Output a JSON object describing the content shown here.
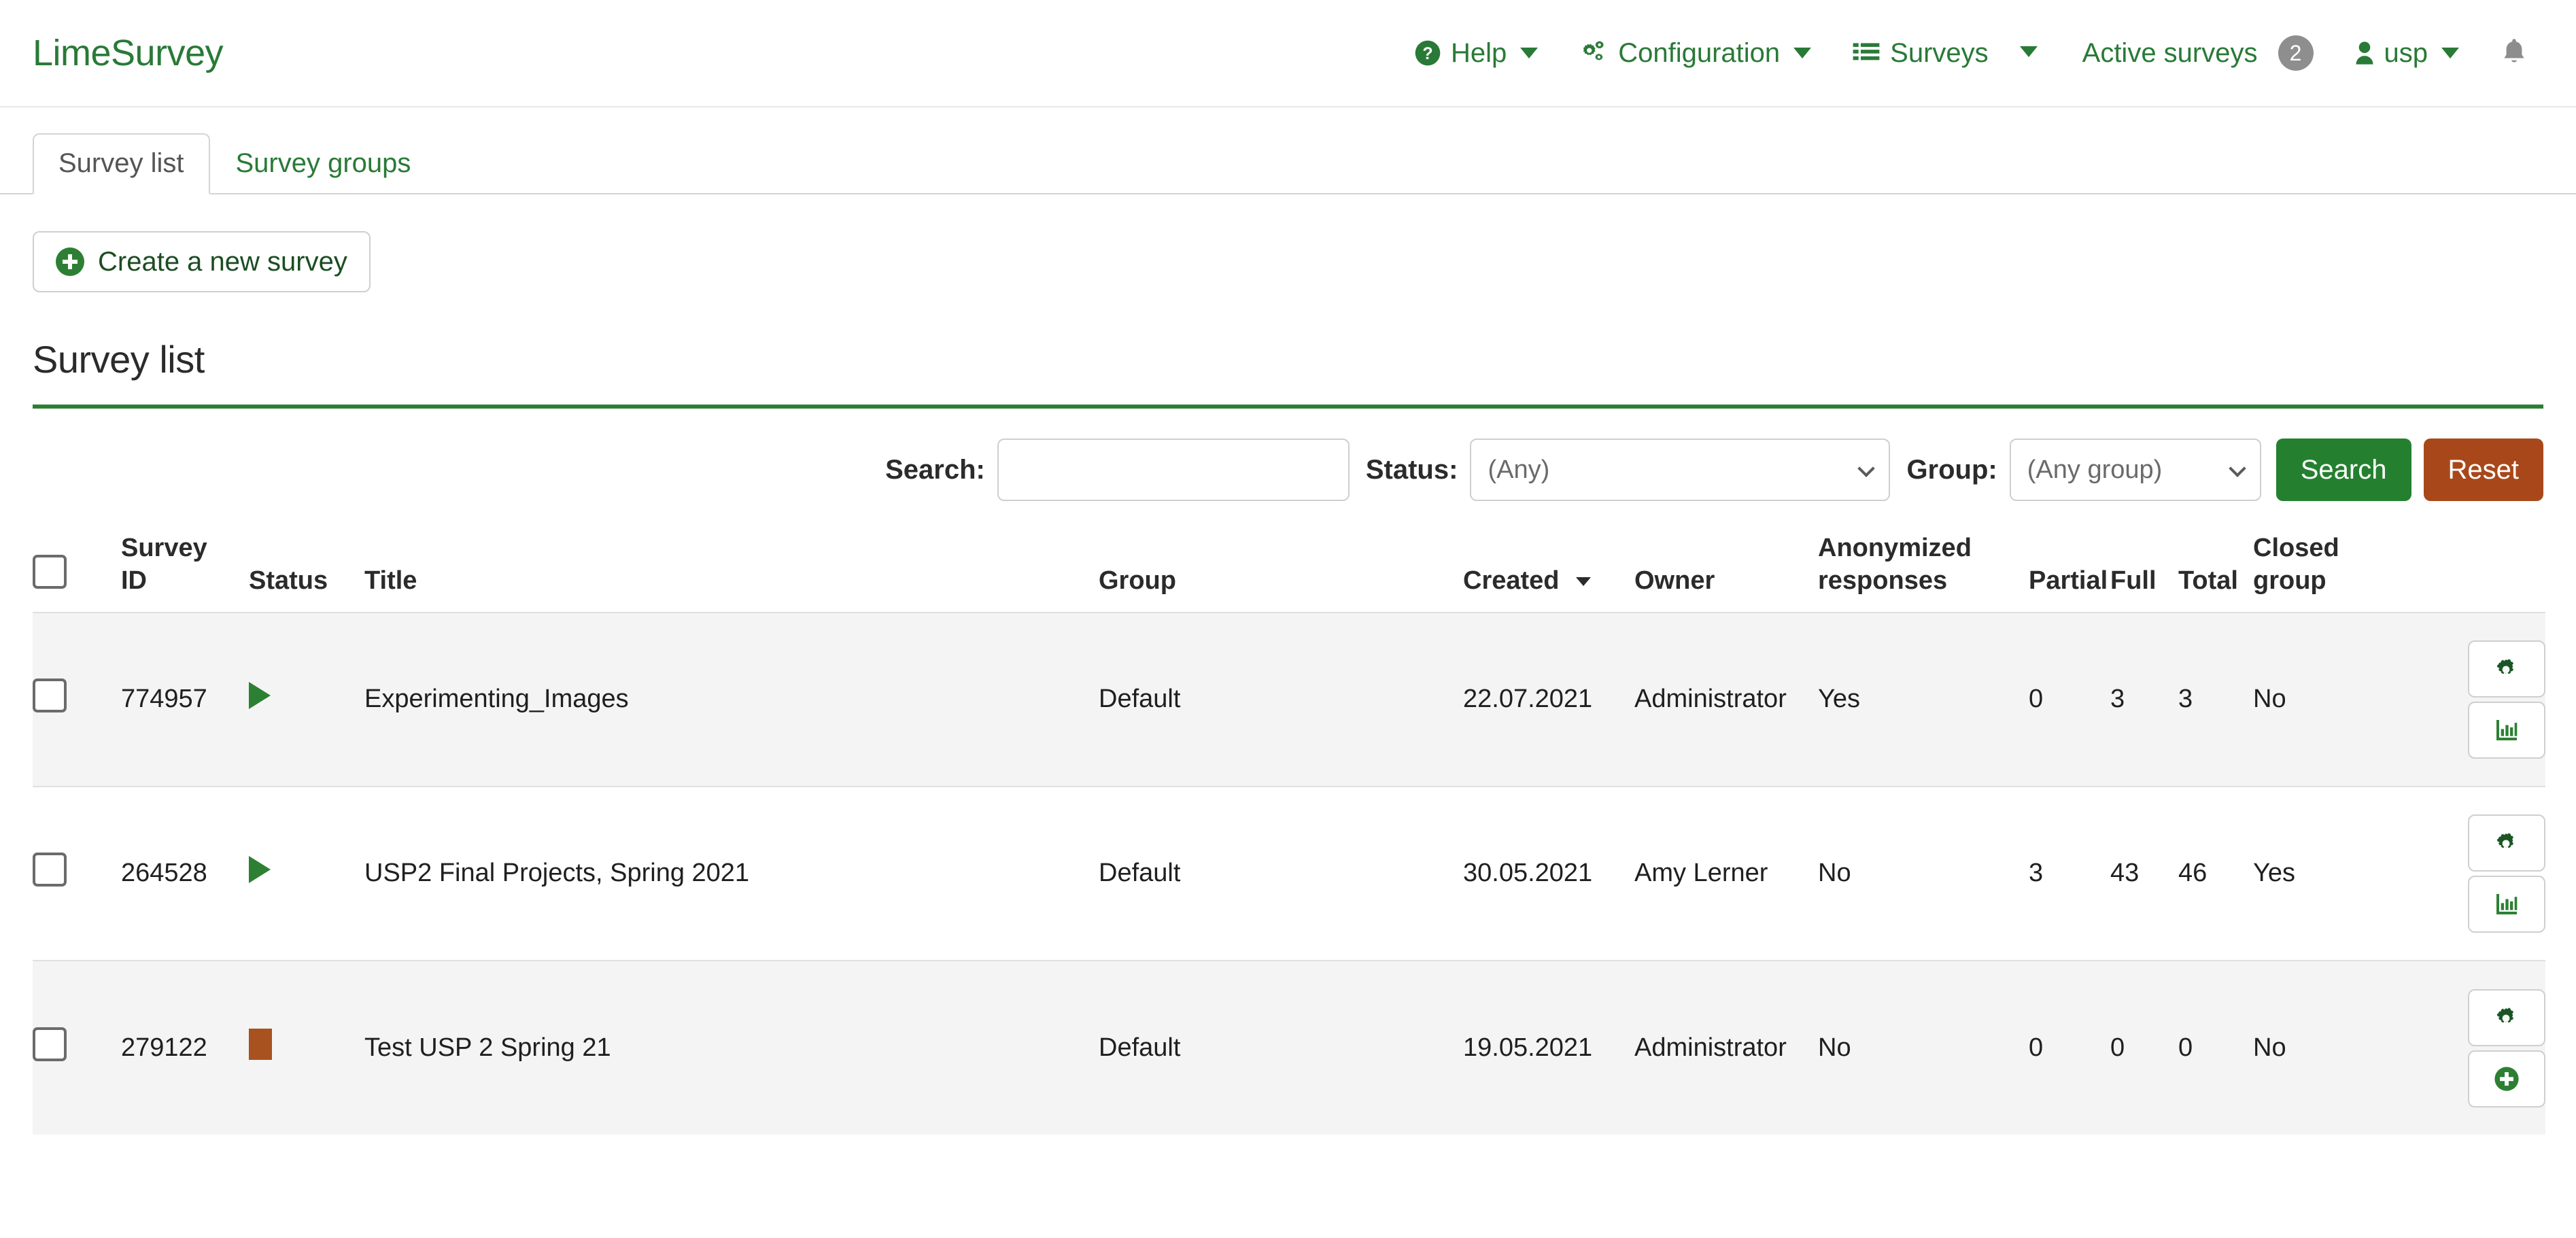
{
  "brand": "LimeSurvey",
  "topnav": {
    "items": [
      {
        "label": "Help",
        "icon": "question-circle-icon",
        "caret": true
      },
      {
        "label": "Configuration",
        "icon": "gears-icon",
        "caret": true
      },
      {
        "label": "Surveys",
        "icon": "list-icon",
        "caret": true
      },
      {
        "label": "Active surveys",
        "icon": "",
        "badge": "2"
      },
      {
        "label": "usp",
        "icon": "user-icon",
        "caret": true
      }
    ],
    "notifications_icon": "bell-icon"
  },
  "tabs": [
    {
      "label": "Survey list",
      "active": true
    },
    {
      "label": "Survey groups",
      "active": false
    }
  ],
  "create_button": {
    "label": "Create a new survey",
    "icon": "circle-plus-icon"
  },
  "page_title": "Survey list",
  "filters": {
    "search_label": "Search:",
    "search_value": "",
    "search_placeholder": "",
    "status_label": "Status:",
    "status_value": "(Any)",
    "status_options": [
      "(Any)"
    ],
    "group_label": "Group:",
    "group_value": "(Any group)",
    "group_options": [
      "(Any group)"
    ],
    "search_button": "Search",
    "reset_button": "Reset"
  },
  "colors": {
    "brand_green": "#297a37",
    "accent_green": "#2d8033",
    "search_button": "#24802f",
    "reset_button": "#a8481a",
    "status_active": "#2d8033",
    "status_expired": "#a8521f",
    "row_alt": "#f4f4f4"
  },
  "table": {
    "columns": [
      {
        "key": "select",
        "label": ""
      },
      {
        "key": "id",
        "label": "Survey ID"
      },
      {
        "key": "status",
        "label": "Status"
      },
      {
        "key": "title",
        "label": "Title"
      },
      {
        "key": "group",
        "label": "Group"
      },
      {
        "key": "created",
        "label": "Created",
        "sorted": true,
        "sort_dir": "desc"
      },
      {
        "key": "owner",
        "label": "Owner"
      },
      {
        "key": "anon",
        "label": "Anonymized responses"
      },
      {
        "key": "partial",
        "label": "Partial"
      },
      {
        "key": "full",
        "label": "Full"
      },
      {
        "key": "total",
        "label": "Total"
      },
      {
        "key": "closed",
        "label": "Closed group"
      },
      {
        "key": "actions",
        "label": ""
      }
    ],
    "header": {
      "survey_id_line1": "Survey",
      "survey_id_line2": "ID",
      "status": "Status",
      "title": "Title",
      "group": "Group",
      "created": "Created",
      "owner": "Owner",
      "anon_line1": "Anonymized",
      "anon_line2": "responses",
      "partial": "Partial",
      "full": "Full",
      "total": "Total",
      "closed_line1": "Closed",
      "closed_line2": "group"
    },
    "rows": [
      {
        "id": "774957",
        "status_icon": "play-icon",
        "status_label": "Active",
        "title": "Experimenting_Images",
        "group": "Default",
        "created": "22.07.2021",
        "owner": "Administrator",
        "anon": "Yes",
        "partial": "0",
        "full": "3",
        "total": "3",
        "closed": "No",
        "actions": [
          "gear-icon",
          "statistics-icon"
        ]
      },
      {
        "id": "264528",
        "status_icon": "play-icon",
        "status_label": "Active",
        "title": "USP2 Final Projects, Spring 2021",
        "group": "Default",
        "created": "30.05.2021",
        "owner": "Amy Lerner",
        "anon": "No",
        "partial": "3",
        "full": "43",
        "total": "46",
        "closed": "Yes",
        "actions": [
          "gear-icon",
          "statistics-icon"
        ]
      },
      {
        "id": "279122",
        "status_icon": "stop-icon",
        "status_label": "Expired",
        "title": "Test USP 2 Spring 21",
        "group": "Default",
        "created": "19.05.2021",
        "owner": "Administrator",
        "anon": "No",
        "partial": "0",
        "full": "0",
        "total": "0",
        "closed": "No",
        "actions": [
          "gear-icon",
          "circle-plus-icon"
        ]
      }
    ]
  }
}
